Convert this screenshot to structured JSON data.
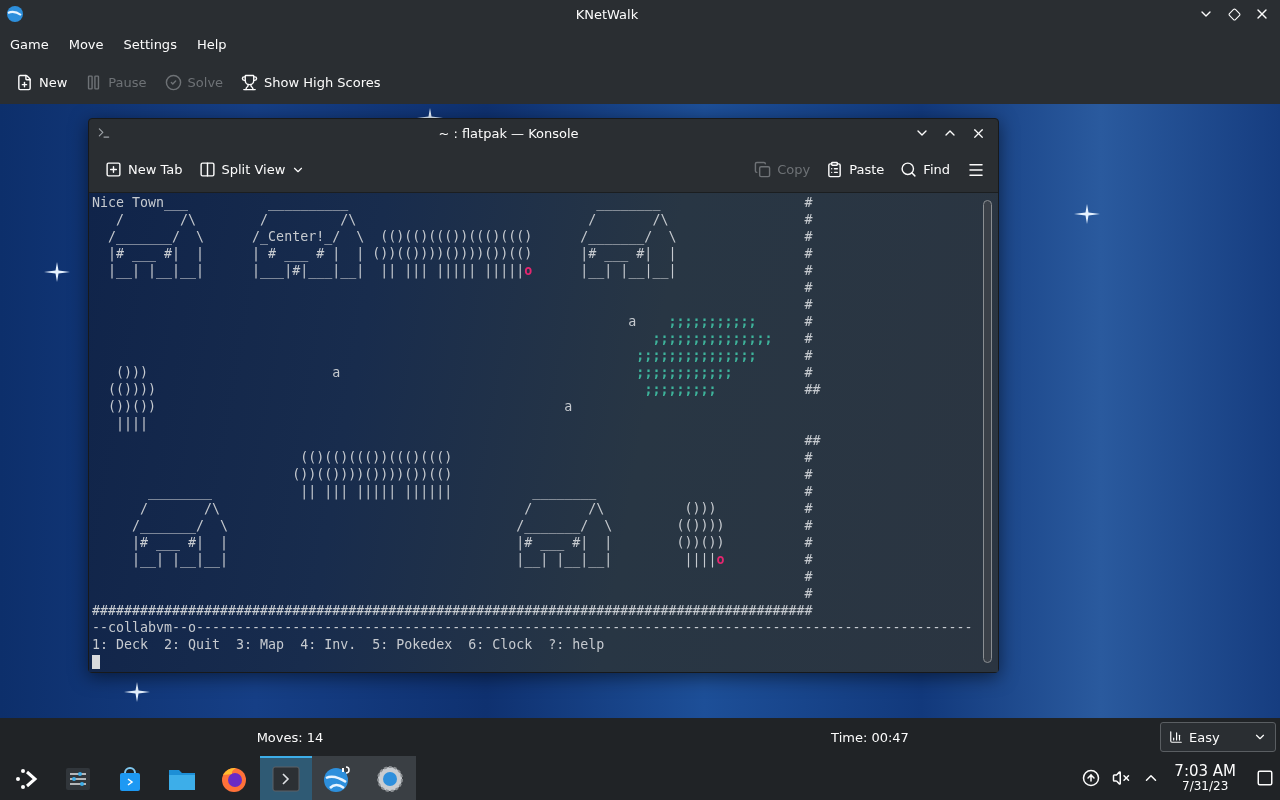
{
  "window": {
    "title": "KNetWalk"
  },
  "menu": [
    "Game",
    "Move",
    "Settings",
    "Help"
  ],
  "toolbar": [
    {
      "label": "New",
      "disabled": false
    },
    {
      "label": "Pause",
      "disabled": true
    },
    {
      "label": "Solve",
      "disabled": true
    },
    {
      "label": "Show High Scores",
      "disabled": false
    }
  ],
  "terminal_window": {
    "title": "~ : flatpak — Konsole",
    "toolbar": [
      {
        "label": "New Tab",
        "disabled": false,
        "dropdown": false
      },
      {
        "label": "Split View",
        "disabled": false,
        "dropdown": true
      },
      {
        "label": "Copy",
        "disabled": true,
        "dropdown": false
      },
      {
        "label": "Paste",
        "disabled": false,
        "dropdown": false
      },
      {
        "label": "Find",
        "disabled": false,
        "dropdown": false
      }
    ],
    "cursor": true,
    "lines": [
      {
        "parts": [
          {
            "text": "Nice Town___          __________                               ________"
          }
        ],
        "edge": "#"
      },
      {
        "parts": [
          {
            "text": "   /       /\\        /         /\\                             /       /\\"
          }
        ],
        "edge": "#"
      },
      {
        "parts": [
          {
            "text": "  /_______/  \\      /_Center!_/  \\  (()(()((())((()((()      /_______/  \\"
          }
        ],
        "edge": "#"
      },
      {
        "parts": [
          {
            "text": "  |# ___ #|  |      | # ___ # |  | ())(())))())))())(()      |# ___ #|  |"
          }
        ],
        "edge": "#"
      },
      {
        "parts": [
          {
            "text": "  |__| |__|__|      |___|#|___|__|  || ||| ||||| |||||"
          },
          {
            "text": "o",
            "color": "#e3266f"
          },
          {
            "text": "      |__| |__|__|"
          }
        ],
        "edge": "#"
      },
      {
        "edge": "#"
      },
      {
        "edge": "#"
      },
      {
        "parts": [
          {
            "text": "                                                                   a"
          },
          {
            "text": "    ;;;;;;;;;;;",
            "color": "#3eb59c"
          }
        ],
        "edge": "#"
      },
      {
        "parts": [
          {
            "text": "                                                                      ;;;;;;;;;;;;;;;",
            "color": "#3eb59c"
          }
        ],
        "edge": "#"
      },
      {
        "parts": [
          {
            "text": "                                                                    ;;;;;;;;;;;;;;;",
            "color": "#3eb59c"
          }
        ],
        "edge": "#"
      },
      {
        "parts": [
          {
            "text": "   ()))                       a"
          },
          {
            "text": "                                     ;;;;;;;;;;;;",
            "color": "#3eb59c"
          }
        ],
        "edge": "#"
      },
      {
        "parts": [
          {
            "text": "  (())))"
          },
          {
            "text": "                                                             ;;;;;;;;;",
            "color": "#3eb59c"
          }
        ],
        "edge": "##"
      },
      {
        "parts": [
          {
            "text": "  ())())                                                   a"
          }
        ]
      },
      {
        "parts": [
          {
            "text": "   ||||"
          }
        ]
      },
      {
        "edge": "##"
      },
      {
        "parts": [
          {
            "text": "                          (()(()((())((()((()"
          }
        ],
        "edge": "#"
      },
      {
        "parts": [
          {
            "text": "                         ())(())))())))())(()"
          }
        ],
        "edge": "#"
      },
      {
        "parts": [
          {
            "text": "       ________           || ||| ||||| ||||||          ________"
          }
        ],
        "edge": "#"
      },
      {
        "parts": [
          {
            "text": "      /       /\\                                      /       /\\          ()))"
          }
        ],
        "edge": "#"
      },
      {
        "parts": [
          {
            "text": "     /_______/  \\                                    /_______/  \\        (())))"
          }
        ],
        "edge": "#"
      },
      {
        "parts": [
          {
            "text": "     |# ___ #|  |                                    |# ___ #|  |        ())())"
          }
        ],
        "edge": "#"
      },
      {
        "parts": [
          {
            "text": "     |__| |__|__|                                    |__| |__|__|         ||||"
          },
          {
            "text": "o",
            "color": "#e3266f"
          }
        ],
        "edge": "#"
      },
      {
        "edge": "#"
      },
      {
        "edge": "#"
      },
      {
        "parts": [
          {
            "text": "##########################################################################################"
          }
        ]
      },
      {
        "parts": [
          {
            "text": "--collabvm--o-------------------------------------------------------------------------------------------------"
          }
        ]
      },
      {
        "parts": [
          {
            "text": "1: Deck  2: Quit  3: Map  4: Inv.  5: Pokedex  6: Clock  ?: help"
          }
        ]
      }
    ]
  },
  "status": {
    "moves": "Moves: 14",
    "time": "Time: 00:47",
    "difficulty": "Easy"
  },
  "taskbar": {
    "apps": [
      {
        "kind": "launcher",
        "open": false,
        "selected": false
      },
      {
        "kind": "settings",
        "open": false,
        "selected": false
      },
      {
        "kind": "store",
        "open": false,
        "selected": false
      },
      {
        "kind": "files",
        "open": false,
        "selected": false
      },
      {
        "kind": "browser",
        "open": false,
        "selected": false
      },
      {
        "kind": "terminal",
        "open": true,
        "selected": true
      },
      {
        "kind": "game",
        "open": true,
        "selected": false
      },
      {
        "kind": "system",
        "open": true,
        "selected": false
      }
    ],
    "tray": [
      {
        "kind": "updates"
      },
      {
        "kind": "muted"
      },
      {
        "kind": "expand"
      }
    ],
    "time": "7:03 AM",
    "date": "7/31/23"
  }
}
